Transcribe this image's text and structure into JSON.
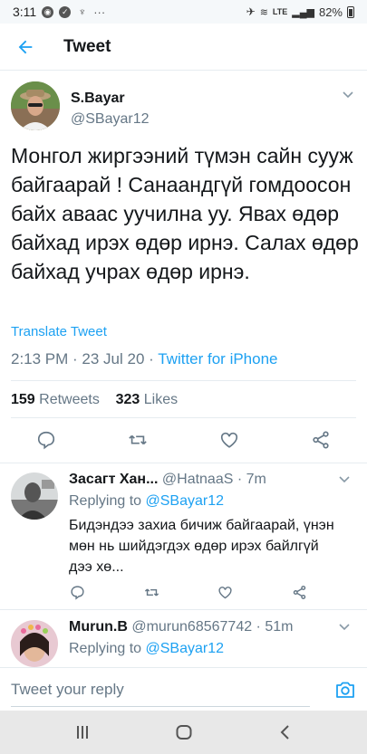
{
  "status_bar": {
    "time": "3:11",
    "more": "···",
    "network": "LTE",
    "battery": "82%"
  },
  "header": {
    "title": "Tweet"
  },
  "tweet": {
    "author_name": "S.Bayar",
    "author_handle": "@SBayar12",
    "text": "Монгол жиргээний түмэн сайн сууж байгаарай ! Санаандгүй гомдоосон байх аваас уучилна уу. Явах өдөр байхад ирэх өдөр ирнэ. Салах өдөр байхад учрах өдөр ирнэ.",
    "translate_label": "Translate Tweet",
    "time": "2:13 PM · 23 Jul 20 · ",
    "source": "Twitter for iPhone",
    "retweets_count": "159",
    "retweets_label": " Retweets",
    "likes_count": "323",
    "likes_label": " Likes"
  },
  "replies": [
    {
      "name": "Засагт Хан...",
      "handle": "@HatnaaS · 7m",
      "replying_prefix": "Replying to ",
      "replying_to": "@SBayar12",
      "text": "Бидэндээ захиа бичиж байгаарай, үнэн мөн нь шийдэгдэх өдөр ирэх байлгүй дээ хө..."
    },
    {
      "name": "Murun.B",
      "handle": "@murun68567742 · 51m",
      "replying_prefix": "Replying to ",
      "replying_to": "@SBayar12"
    }
  ],
  "compose": {
    "placeholder": "Tweet your reply"
  },
  "colors": {
    "accent": "#1da1f2",
    "secondary_text": "#657786",
    "primary_text": "#14171a"
  },
  "icons": [
    "back-arrow-icon",
    "chevron-down-icon",
    "reply-icon",
    "retweet-icon",
    "like-icon",
    "share-icon",
    "camera-icon",
    "recent-apps-icon",
    "home-icon",
    "back-icon"
  ]
}
